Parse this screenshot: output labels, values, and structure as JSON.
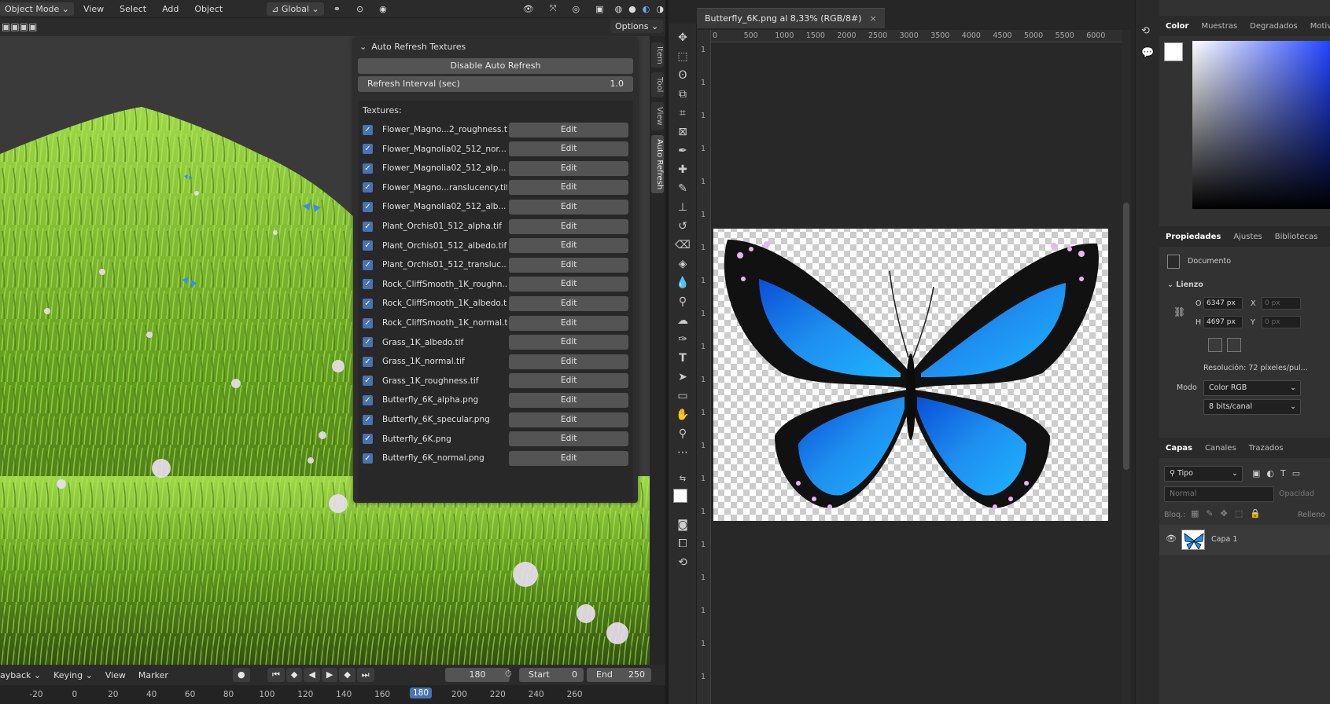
{
  "blender": {
    "header": {
      "mode": "Object Mode",
      "menus": [
        "View",
        "Select",
        "Add",
        "Object"
      ],
      "transform_orientation": "Global",
      "options_label": "Options"
    },
    "panel": {
      "title": "Auto Refresh Textures",
      "disable_button": "Disable Auto Refresh",
      "interval_label": "Refresh Interval (sec)",
      "interval_value": "1.0",
      "textures_label": "Textures:",
      "edit_label": "Edit",
      "textures": [
        "Flower_Magno...2_roughness.tif",
        "Flower_Magnolia02_512_nor...",
        "Flower_Magnolia02_512_alp...",
        "Flower_Magno...ranslucency.tif",
        "Flower_Magnolia02_512_alb...",
        "Plant_Orchis01_512_alpha.tif",
        "Plant_Orchis01_512_albedo.tif",
        "Plant_Orchis01_512_transluc...",
        "Rock_CliffSmooth_1K_roughn...",
        "Rock_CliffSmooth_1K_albedo.tif",
        "Rock_CliffSmooth_1K_normal.tif",
        "Grass_1K_albedo.tif",
        "Grass_1K_normal.tif",
        "Grass_1K_roughness.tif",
        "Butterfly_6K_alpha.png",
        "Butterfly_6K_specular.png",
        "Butterfly_6K.png",
        "Butterfly_6K_normal.png"
      ]
    },
    "side_tabs": [
      "Item",
      "Tool",
      "View",
      "Auto Refresh"
    ],
    "timeline": {
      "playback": "ayback",
      "keying": "Keying",
      "view": "View",
      "marker": "Marker",
      "current_frame": "180",
      "start_label": "Start",
      "start_value": "0",
      "end_label": "End",
      "end_value": "250",
      "ruler": [
        "-20",
        "0",
        "20",
        "40",
        "60",
        "80",
        "100",
        "120",
        "140",
        "160",
        "180",
        "200",
        "220",
        "240",
        "260"
      ],
      "ruler_current": "180"
    }
  },
  "photoshop": {
    "doc_tab": "Butterfly_6K.png al 8,33% (RGB/8#)",
    "close_glyph": "×",
    "ruler_h": [
      "0",
      "500",
      "1000",
      "1500",
      "2000",
      "2500",
      "3000",
      "3500",
      "4000",
      "4500",
      "5000",
      "5500",
      "6000"
    ],
    "ruler_v": [
      "1",
      "1",
      "1",
      "1",
      "1",
      "1",
      "1",
      "1",
      "1",
      "1",
      "1",
      "1",
      "1",
      "1",
      "1",
      "1",
      "1",
      "1",
      "1",
      "1"
    ],
    "color_tabs": [
      "Color",
      "Muestras",
      "Degradados",
      "Motiv"
    ],
    "props_tabs": [
      "Propiedades",
      "Ajustes",
      "Bibliotecas"
    ],
    "props": {
      "documento": "Documento",
      "lienzo": "Lienzo",
      "w_label": "O",
      "w_value": "6347 px",
      "h_label": "H",
      "h_value": "4697 px",
      "x_label": "X",
      "x_value": "0 px",
      "y_label": "Y",
      "y_value": "0 px",
      "resolucion": "Resolución: 72 píxeles/pul...",
      "modo_label": "Modo",
      "modo_value": "Color RGB",
      "bits_value": "8 bits/canal"
    },
    "layers_tabs": [
      "Capas",
      "Canales",
      "Trazados"
    ],
    "layers": {
      "filter": "Tipo",
      "blend": "Normal",
      "opacity": "Opacidad",
      "lock": "Bloq.:",
      "fill": "Relleno",
      "layer_name": "Capa 1"
    },
    "colors": {
      "blender_accent": "#4772b3",
      "butterfly_blue": "#1e8ff0",
      "butterfly_pink": "#e7b6f0"
    }
  }
}
